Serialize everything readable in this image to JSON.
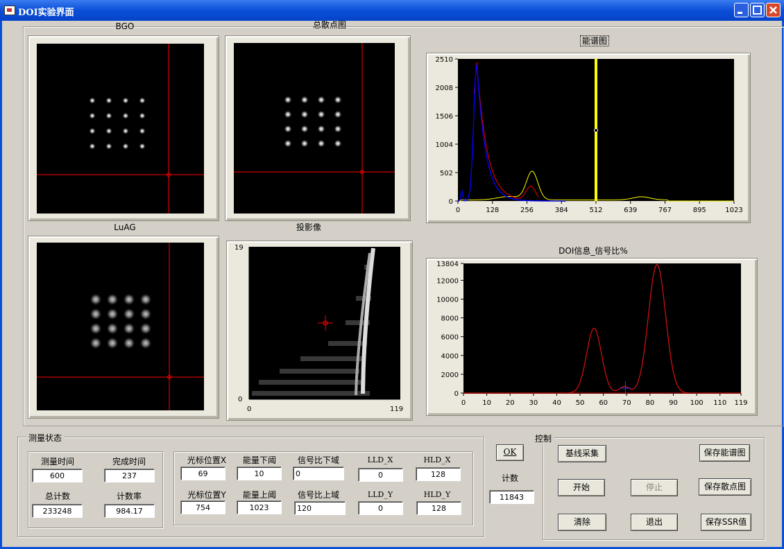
{
  "window": {
    "title": "DOI实验界面"
  },
  "plots": {
    "bgo": {
      "label": "BGO"
    },
    "scatter": {
      "label": "总散点图"
    },
    "luag": {
      "label": "LuAG"
    },
    "projection": {
      "label": "投影像",
      "y_ticks": [
        "19",
        "0"
      ],
      "x_ticks": [
        "0",
        "119"
      ]
    },
    "spectrum": {
      "label": "能谱图",
      "y_ticks": [
        "2510",
        "2008",
        "1506",
        "1004",
        "502",
        "0"
      ],
      "x_ticks": [
        "0",
        "128",
        "256",
        "384",
        "512",
        "639",
        "767",
        "895",
        "1023"
      ]
    },
    "doi": {
      "label": "DOI信息_信号比%",
      "y_ticks": [
        "13804",
        "12000",
        "10000",
        "8000",
        "6000",
        "4000",
        "2000",
        "0"
      ],
      "x_ticks": [
        "0",
        "10",
        "20",
        "30",
        "40",
        "50",
        "60",
        "70",
        "80",
        "90",
        "100",
        "110",
        "119"
      ]
    }
  },
  "colors": {
    "cursor": "#ff0000",
    "spectrum_blue": "#0000ff",
    "spectrum_red": "#ff0000",
    "spectrum_yellow": "#ffff00",
    "doi_curve": "#e01010"
  },
  "status": {
    "title": "测量状态",
    "measure_time_label": "测量时间",
    "measure_time": "600",
    "done_time_label": "完成时间",
    "done_time": "237",
    "total_count_label": "总计数",
    "total_count": "233248",
    "count_rate_label": "计数率",
    "count_rate": "984.17"
  },
  "params": {
    "cursor_x_label": "光标位置X",
    "cursor_x": "69",
    "cursor_y_label": "光标位置Y",
    "cursor_y": "754",
    "energy_low_label": "能量下阈",
    "energy_low": "10",
    "energy_high_label": "能量上阈",
    "energy_high": "1023",
    "ratio_low_label": "信号比下域",
    "ratio_low": "0",
    "ratio_high_label": "信号比上域",
    "ratio_high": "120",
    "lld_x_label": "LLD_X",
    "lld_x": "0",
    "lld_y_label": "LLD_Y",
    "lld_y": "0",
    "hld_x_label": "HLD_X",
    "hld_x": "128",
    "hld_y_label": "HLD_Y",
    "hld_y": "128"
  },
  "ok": {
    "label": "OK",
    "count_label": "计数",
    "count": "11843"
  },
  "control": {
    "title": "控制",
    "baseline": "基线采集",
    "save_spectrum": "保存能谱图",
    "start": "开始",
    "stop": "停止",
    "save_scatter": "保存散点图",
    "clear": "清除",
    "exit": "退出",
    "save_ssr": "保存SSR值"
  }
}
